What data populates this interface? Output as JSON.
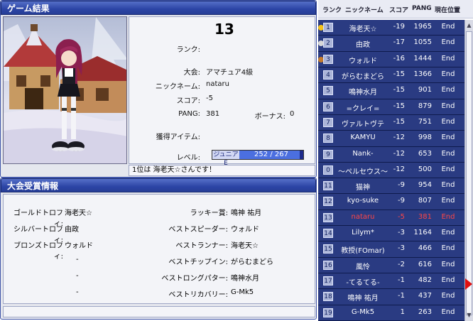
{
  "result": {
    "title": "ゲーム結果",
    "rank_label": "ランク:",
    "rank_value": "13",
    "tournament_label": "大会:",
    "tournament_value": "アマチュア4級",
    "nickname_label": "ニックネーム:",
    "nickname_value": "nataru",
    "score_label": "スコア:",
    "score_value": "-5",
    "pang_label": "PANG:",
    "pang_value": "381",
    "bonus_label": "ボーナス:",
    "bonus_value": "0",
    "items_label": "獲得アイテム:",
    "level_label": "レベル:",
    "level_name": "ジュニアE",
    "level_progress": "252 / 267",
    "level_fraction": 0.944,
    "message": "1位は 海老天☆さんです！"
  },
  "awards": {
    "title": "大会受賞情報",
    "left": [
      {
        "label": "ゴールドトロフィ:",
        "value": "海老天☆"
      },
      {
        "label": "シルバートロフィ:",
        "value": "由政"
      },
      {
        "label": "ブロンズトロフィ:",
        "value": "ウォルド"
      },
      {
        "label": "",
        "value": "-"
      },
      {
        "label": "",
        "value": "-"
      },
      {
        "label": "",
        "value": "-"
      }
    ],
    "right": [
      {
        "label": "ラッキー賞:",
        "value": "鳴神 祐月"
      },
      {
        "label": "ベストスピーダー:",
        "value": "ウォルド"
      },
      {
        "label": "ベストランナー:",
        "value": "海老天☆"
      },
      {
        "label": "ベストチップイン:",
        "value": "がらむまどら"
      },
      {
        "label": "ベストロングパター:",
        "value": "鳴神水月"
      },
      {
        "label": "ベストリカバリー:",
        "value": "G-Mk5"
      }
    ]
  },
  "ranking": {
    "headers": {
      "rank": "ランク",
      "nickname": "ニックネーム",
      "score": "スコア",
      "pang": "PANG",
      "position": "現在位置"
    },
    "rows": [
      {
        "rank": "1",
        "name": "海老天☆",
        "score": "-19",
        "pang": "1965",
        "status": "End",
        "medal": "gold"
      },
      {
        "rank": "2",
        "name": "由政",
        "score": "-17",
        "pang": "1055",
        "status": "End",
        "medal": "silver"
      },
      {
        "rank": "3",
        "name": "ウォルド",
        "score": "-16",
        "pang": "1444",
        "status": "End",
        "medal": "bronze"
      },
      {
        "rank": "4",
        "name": "がらむまどら",
        "score": "-15",
        "pang": "1366",
        "status": "End"
      },
      {
        "rank": "5",
        "name": "鳴神水月",
        "score": "-15",
        "pang": "901",
        "status": "End"
      },
      {
        "rank": "6",
        "name": "=クレイ=",
        "score": "-15",
        "pang": "879",
        "status": "End"
      },
      {
        "rank": "7",
        "name": "ヴァルトヴテ",
        "score": "-15",
        "pang": "751",
        "status": "End"
      },
      {
        "rank": "8",
        "name": "KAMYU",
        "score": "-12",
        "pang": "998",
        "status": "End"
      },
      {
        "rank": "9",
        "name": "Nank-",
        "score": "-12",
        "pang": "653",
        "status": "End"
      },
      {
        "rank": "0",
        "name": "～ペルセウス～",
        "score": "-12",
        "pang": "500",
        "status": "End"
      },
      {
        "rank": "11",
        "name": "猫神",
        "score": "-9",
        "pang": "954",
        "status": "End"
      },
      {
        "rank": "12",
        "name": "kyo-suke",
        "score": "-9",
        "pang": "807",
        "status": "End"
      },
      {
        "rank": "13",
        "name": "nataru",
        "score": "-5",
        "pang": "381",
        "status": "End",
        "me": true
      },
      {
        "rank": "14",
        "name": "Lilym*",
        "score": "-3",
        "pang": "1164",
        "status": "End"
      },
      {
        "rank": "15",
        "name": "教授(FOmar)",
        "score": "-3",
        "pang": "466",
        "status": "End"
      },
      {
        "rank": "16",
        "name": "風怜",
        "score": "-2",
        "pang": "616",
        "status": "End"
      },
      {
        "rank": "17",
        "name": "-てるてる-",
        "score": "-1",
        "pang": "482",
        "status": "End"
      },
      {
        "rank": "18",
        "name": "鳴神 祐月",
        "score": "-1",
        "pang": "437",
        "status": "End"
      },
      {
        "rank": "19",
        "name": "G-Mk5",
        "score": "1",
        "pang": "263",
        "status": "End"
      }
    ]
  },
  "colors": {
    "highlight": "#ff4646",
    "panel_blue": "#2c45a5",
    "row_blue": "#2a3b82"
  }
}
